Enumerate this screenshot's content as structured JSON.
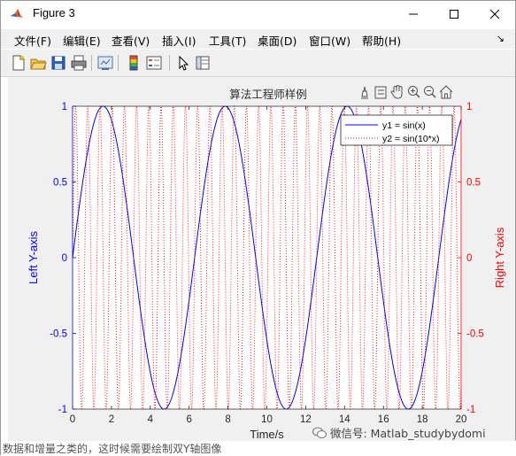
{
  "window": {
    "title": "Figure 3",
    "minimize_icon": "minimize-icon",
    "maximize_icon": "maximize-icon",
    "close_icon": "close-icon"
  },
  "menu": {
    "items": [
      "文件(F)",
      "编辑(E)",
      "查看(V)",
      "插入(I)",
      "工具(T)",
      "桌面(D)",
      "窗口(W)",
      "帮助(H)"
    ],
    "overflow_arrow": "↘"
  },
  "toolbar": {
    "icons": [
      "new-figure-icon",
      "open-file-icon",
      "save-icon",
      "print-icon",
      "link-plot-icon",
      "colorbar-icon",
      "legend-icon",
      "edit-plot-icon",
      "property-inspector-icon"
    ]
  },
  "axes_toolbar": {
    "icons": [
      "brush-icon",
      "data-tips-icon",
      "pan-icon",
      "zoom-in-icon",
      "zoom-out-icon",
      "home-icon"
    ]
  },
  "chart_data": {
    "type": "line",
    "title": "算法工程师样例",
    "xlabel": "Time/s",
    "ylabel_left": "Left Y-axis",
    "ylabel_right": "Right Y-axis",
    "xlim": [
      0,
      20
    ],
    "ylim_left": [
      -1,
      1
    ],
    "ylim_right": [
      -1,
      1
    ],
    "xticks": [
      "0",
      "2",
      "4",
      "6",
      "8",
      "10",
      "12",
      "14",
      "16",
      "18",
      "20"
    ],
    "yticks_left": [
      "-1",
      "-0.5",
      "0",
      "0.5",
      "1"
    ],
    "yticks_right": [
      "-1",
      "-0.5",
      "0",
      "0.5",
      "1"
    ],
    "left_axis_color": "#0000ff",
    "right_axis_color": "#ff0000",
    "grid": false,
    "legend_position": "top-right",
    "series": [
      {
        "name": "y1 = sin(x)",
        "function": "sin(x)",
        "axis": "left",
        "color": "#0000ff",
        "style": "solid"
      },
      {
        "name": "y2 = sin(10*x)",
        "function": "sin(10*x)",
        "axis": "right",
        "color": "#ff0000",
        "style": "dotted"
      }
    ]
  },
  "watermark": "微信号: Matlab_studybydomi",
  "background_text": "数据和增量之类的，这时候需要绘制双Y轴图像"
}
